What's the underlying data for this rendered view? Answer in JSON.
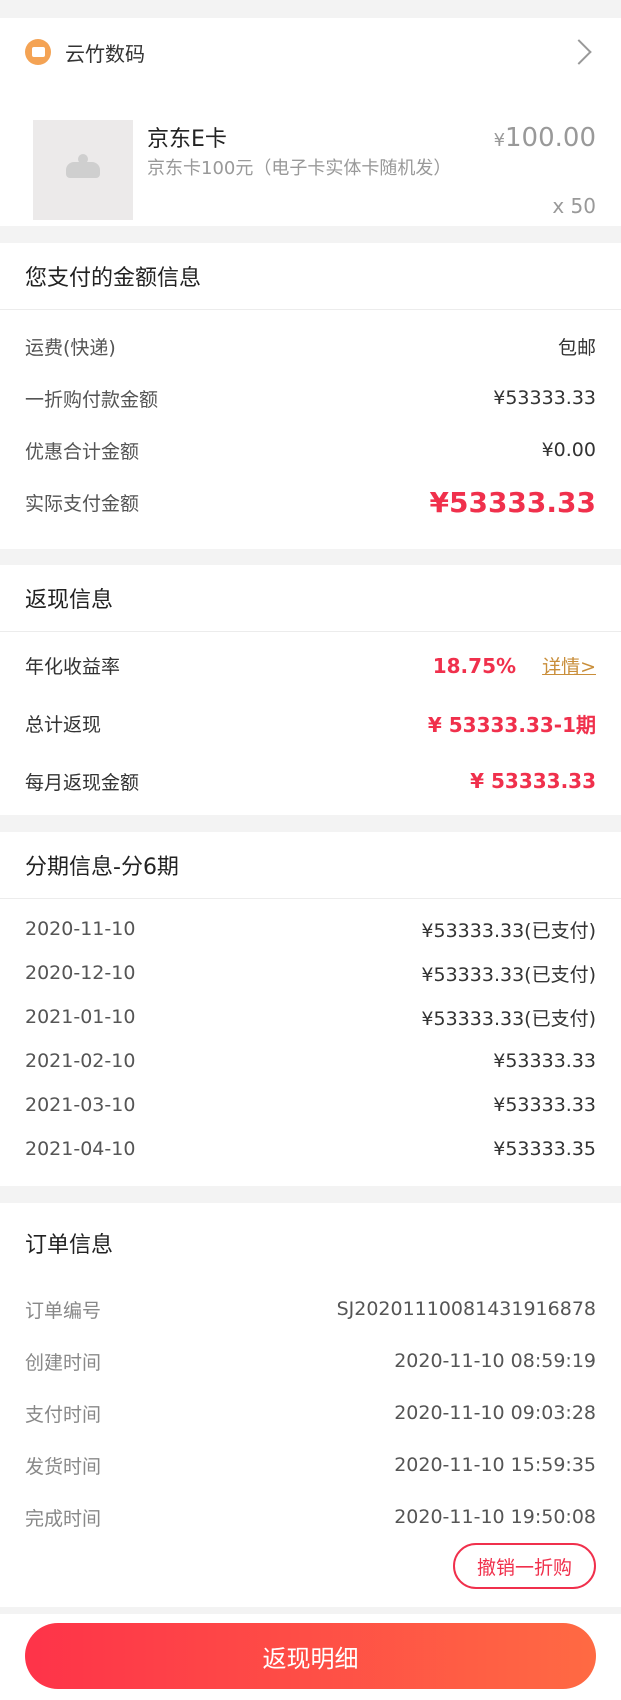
{
  "shop": {
    "name": "云竹数码",
    "icon": "store-icon"
  },
  "product": {
    "name": "京东E卡",
    "desc": "京东卡100元（电子卡实体卡随机发）",
    "currency": "¥",
    "price": "100.00",
    "qty": "x 50"
  },
  "payment": {
    "title": "您支付的金额信息",
    "rows": [
      {
        "label": "运费(快递)",
        "value": "包邮"
      },
      {
        "label": "一折购付款金额",
        "value": "¥53333.33"
      },
      {
        "label": "优惠合计金额",
        "value": "¥0.00"
      },
      {
        "label": "实际支付金额",
        "value": "¥53333.33"
      }
    ]
  },
  "cashback": {
    "title": "返现信息",
    "rate_label": "年化收益率",
    "rate_value": "18.75%",
    "detail_link": "详情>",
    "total_label": "总计返现",
    "total_value": "¥ 53333.33-1期",
    "monthly_label": "每月返现金额",
    "monthly_value": "¥ 53333.33"
  },
  "installments": {
    "title": "分期信息-分6期",
    "rows": [
      {
        "date": "2020-11-10",
        "amount": "¥53333.33(已支付)"
      },
      {
        "date": "2020-12-10",
        "amount": "¥53333.33(已支付)"
      },
      {
        "date": "2021-01-10",
        "amount": "¥53333.33(已支付)"
      },
      {
        "date": "2021-02-10",
        "amount": "¥53333.33"
      },
      {
        "date": "2021-03-10",
        "amount": "¥53333.33"
      },
      {
        "date": "2021-04-10",
        "amount": "¥53333.35"
      }
    ]
  },
  "order": {
    "title": "订单信息",
    "rows": [
      {
        "label": "订单编号",
        "value": "SJ20201110081431916878"
      },
      {
        "label": "创建时间",
        "value": "2020-11-10 08:59:19"
      },
      {
        "label": "支付时间",
        "value": "2020-11-10 09:03:28"
      },
      {
        "label": "发货时间",
        "value": "2020-11-10 15:59:35"
      },
      {
        "label": "完成时间",
        "value": "2020-11-10 19:50:08"
      }
    ],
    "cancel_label": "撤销一折购"
  },
  "bottom": {
    "button_label": "返现明细"
  },
  "colors": {
    "accent_red": "#f0304c",
    "link_gold": "#c98e3a",
    "shop_icon": "#f4a354"
  }
}
